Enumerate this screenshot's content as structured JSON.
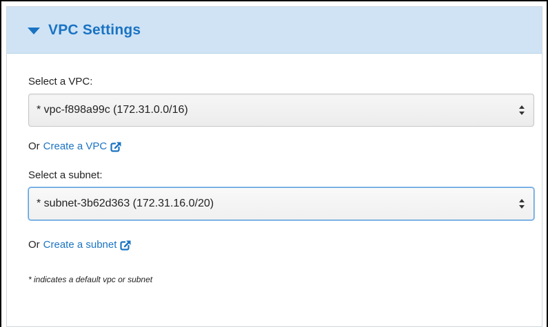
{
  "panel": {
    "title": "VPC Settings"
  },
  "vpc": {
    "label": "Select a VPC:",
    "selected": "* vpc-f898a99c (172.31.0.0/16)",
    "or_text": "Or",
    "create_link": "Create a VPC"
  },
  "subnet": {
    "label": "Select a subnet:",
    "selected": "* subnet-3b62d363 (172.31.16.0/20)",
    "or_text": "Or",
    "create_link": "Create a subnet"
  },
  "footnote": "* indicates a default vpc or subnet",
  "icons": {
    "header_toggle": "caret-down-icon",
    "external_link": "external-link-icon",
    "select_arrows": "up-down-arrows-icon"
  },
  "colors": {
    "header_bg": "#cfe3f5",
    "accent": "#1a73c2",
    "focus_border": "#5aa0dc"
  }
}
